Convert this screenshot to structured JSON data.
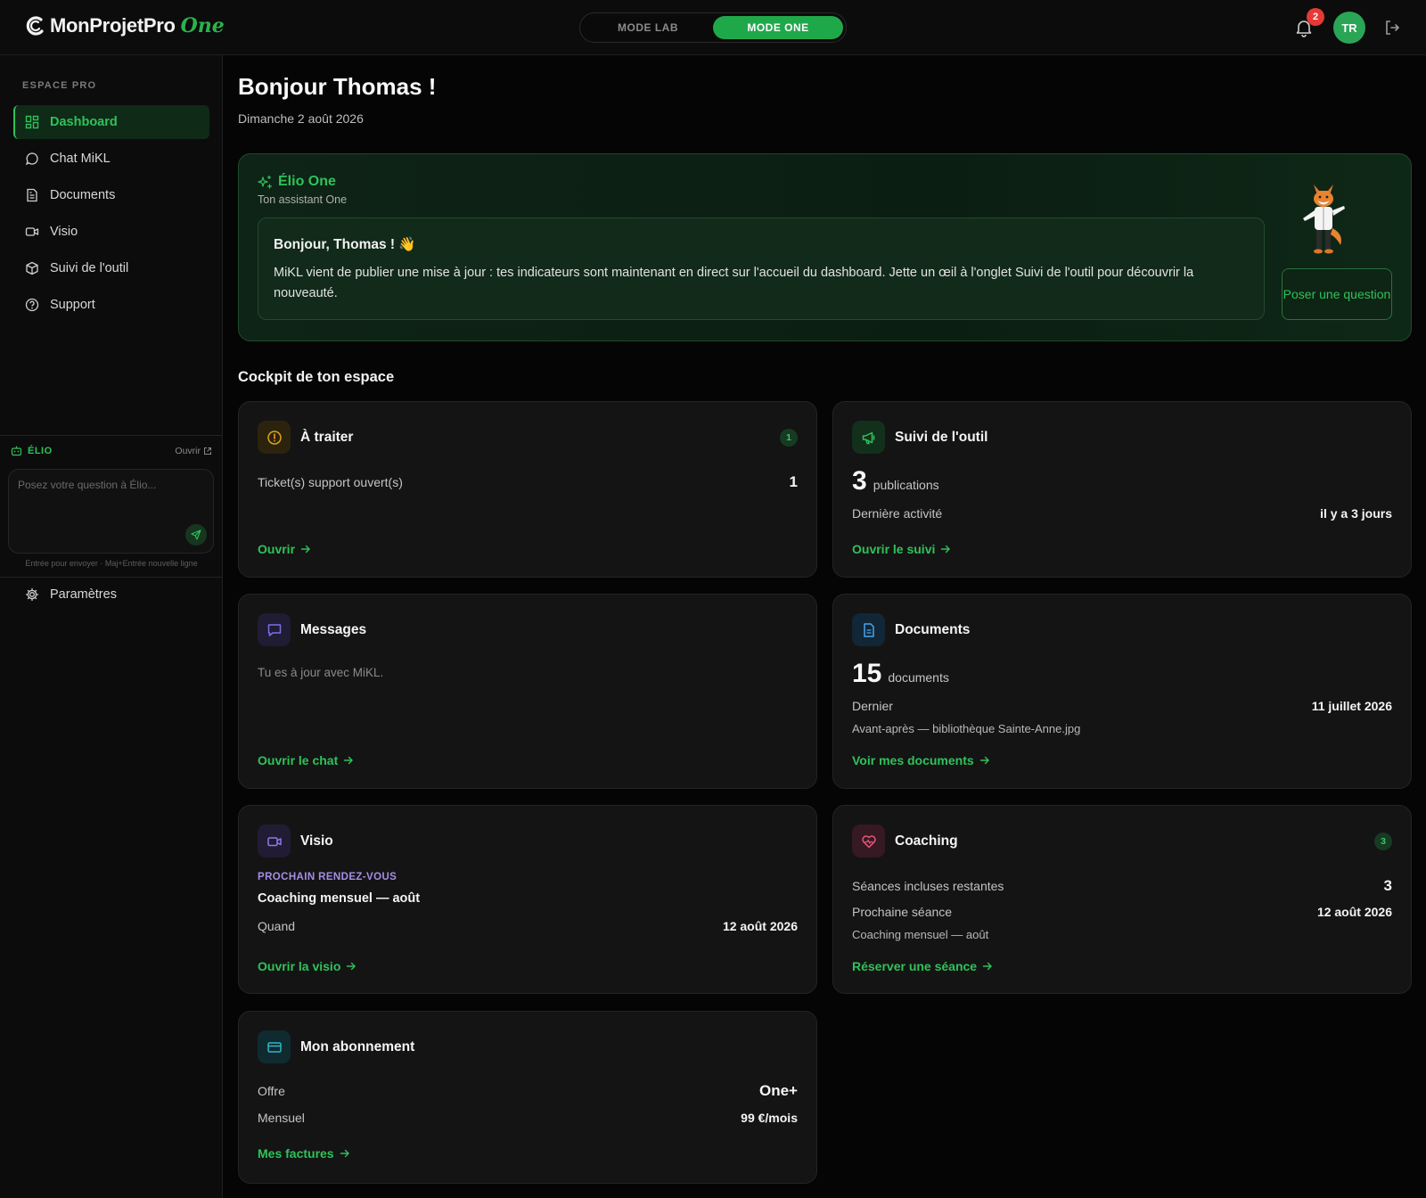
{
  "header": {
    "logo_main": "MonProjetPro",
    "logo_accent": "One",
    "modes": [
      {
        "label": "MODE LAB",
        "active": false
      },
      {
        "label": "MODE ONE",
        "active": true
      }
    ],
    "notification_count": "2",
    "avatar_initials": "TR",
    "icons": [
      "bell-icon",
      "logout-icon"
    ]
  },
  "sidebar": {
    "section_label": "ESPACE PRO",
    "items": [
      {
        "label": "Dashboard",
        "icon": "grid-icon",
        "active": true
      },
      {
        "label": "Chat MiKL",
        "icon": "chat-icon",
        "active": false
      },
      {
        "label": "Documents",
        "icon": "document-icon",
        "active": false
      },
      {
        "label": "Visio",
        "icon": "video-icon",
        "active": false
      },
      {
        "label": "Suivi de l'outil",
        "icon": "cube-icon",
        "active": false
      },
      {
        "label": "Support",
        "icon": "help-icon",
        "active": false
      }
    ],
    "elio": {
      "title": "ÉLIO",
      "open_label": "Ouvrir",
      "placeholder": "Posez votre question à Élio...",
      "hint": "Entrée pour envoyer · Maj+Entrée nouvelle ligne"
    },
    "settings_label": "Paramètres"
  },
  "main": {
    "greeting": "Bonjour Thomas !",
    "date": "Dimanche 2 août 2026",
    "elio_card": {
      "title": "Élio One",
      "subtitle": "Ton assistant One",
      "message_title": "Bonjour, Thomas ! 👋",
      "message_body": "MiKL vient de publier une mise à jour : tes indicateurs sont maintenant en direct sur l'accueil du dashboard. Jette un œil à l'onglet Suivi de l'outil pour découvrir la nouveauté.",
      "ask_button": "Poser une question"
    },
    "cockpit_title": "Cockpit de ton espace",
    "cards": {
      "a_traiter": {
        "title": "À traiter",
        "badge": "1",
        "row_label": "Ticket(s) support ouvert(s)",
        "row_value": "1",
        "link": "Ouvrir",
        "accent": "#e0a21b"
      },
      "suivi": {
        "title": "Suivi de l'outil",
        "count": "3",
        "unit": "publications",
        "row_label": "Dernière activité",
        "row_value": "il y a 3 jours",
        "link": "Ouvrir le suivi",
        "accent": "#2fc25a"
      },
      "messages": {
        "title": "Messages",
        "text": "Tu es à jour avec MiKL.",
        "link": "Ouvrir le chat",
        "accent": "#7b6fe6"
      },
      "documents": {
        "title": "Documents",
        "count": "15",
        "unit": "documents",
        "row_label": "Dernier",
        "row_value": "11 juillet 2026",
        "file": "Avant-après — bibliothèque Sainte-Anne.jpg",
        "link": "Voir mes documents",
        "accent": "#4aa3e8"
      },
      "visio": {
        "title": "Visio",
        "kicker": "PROCHAIN RENDEZ-VOUS",
        "event": "Coaching mensuel — août",
        "row_label": "Quand",
        "row_value": "12 août 2026",
        "link": "Ouvrir la visio",
        "accent": "#8e7ae6"
      },
      "coaching": {
        "title": "Coaching",
        "badge": "3",
        "row1_label": "Séances incluses restantes",
        "row1_value": "3",
        "row2_label": "Prochaine séance",
        "row2_value": "12 août 2026",
        "sub": "Coaching mensuel — août",
        "link": "Réserver une séance",
        "accent": "#e8557a"
      },
      "abonnement": {
        "title": "Mon abonnement",
        "row1_label": "Offre",
        "row1_value": "One+",
        "row2_label": "Mensuel",
        "row2_value": "99 €/mois",
        "link": "Mes factures",
        "accent": "#2fb8c8"
      }
    }
  }
}
